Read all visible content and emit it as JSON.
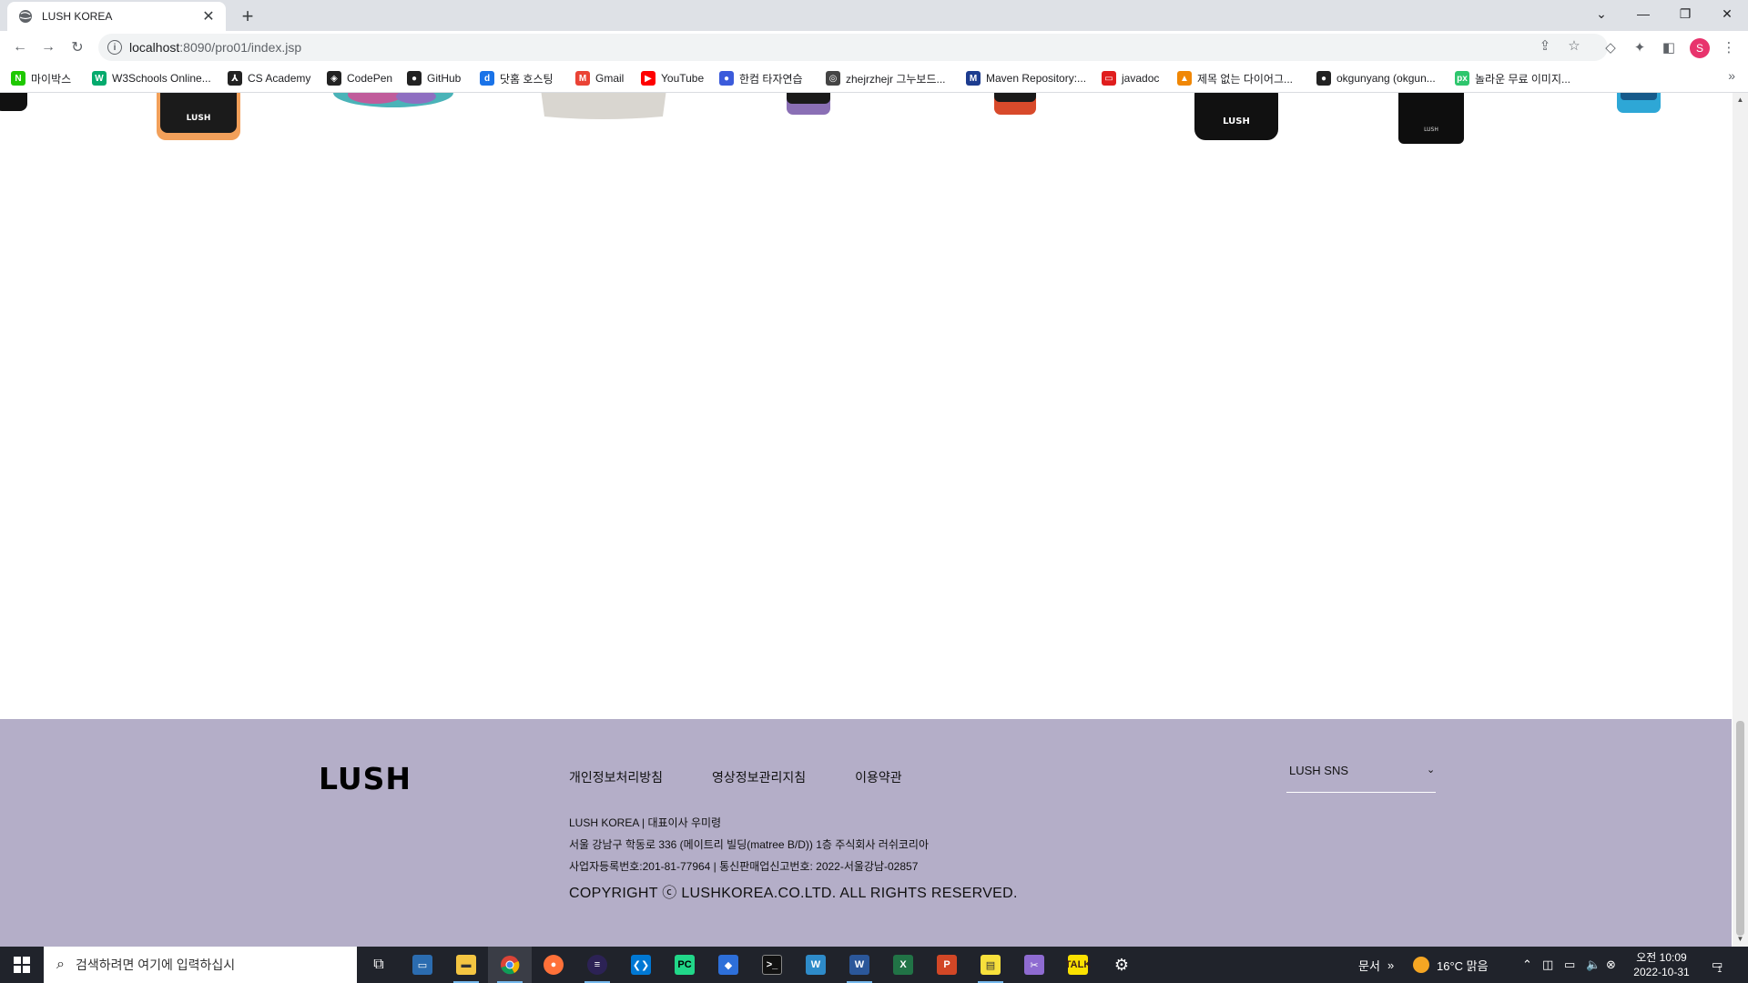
{
  "browser": {
    "tab_title": "LUSH KOREA",
    "url_host": "localhost",
    "url_rest": ":8090/pro01/index.jsp"
  },
  "bookmarks": [
    {
      "label": "마이박스",
      "icon": "naver-mybox-icon",
      "color": "#1ec800",
      "glyph": "N"
    },
    {
      "label": "W3Schools Online...",
      "icon": "w3schools-icon",
      "color": "#04aa6d",
      "glyph": "W"
    },
    {
      "label": "CS Academy",
      "icon": "cs-academy-icon",
      "color": "#222222",
      "glyph": "⅄"
    },
    {
      "label": "CodePen",
      "icon": "codepen-icon",
      "color": "#222222",
      "glyph": "◈"
    },
    {
      "label": "GitHub",
      "icon": "github-icon",
      "color": "#222222",
      "glyph": "●"
    },
    {
      "label": "닷홈 호스팅",
      "icon": "dothome-icon",
      "color": "#1a73e8",
      "glyph": "d"
    },
    {
      "label": "Gmail",
      "icon": "gmail-icon",
      "color": "#ea4335",
      "glyph": "M"
    },
    {
      "label": "YouTube",
      "icon": "youtube-icon",
      "color": "#ff0000",
      "glyph": "▶"
    },
    {
      "label": "한컴 타자연습",
      "icon": "hancom-icon",
      "color": "#3b5bdb",
      "glyph": "●"
    },
    {
      "label": "zhejrzhejr 그누보드...",
      "icon": "globe-icon",
      "color": "#444444",
      "glyph": "◎"
    },
    {
      "label": "Maven Repository:...",
      "icon": "maven-icon",
      "color": "#1d3c8f",
      "glyph": "M"
    },
    {
      "label": "javadoc",
      "icon": "oracle-icon",
      "color": "#e01e1e",
      "glyph": "▭"
    },
    {
      "label": "제목 없는 다이어그...",
      "icon": "diagram-icon",
      "color": "#f08705",
      "glyph": "▲"
    },
    {
      "label": "okgunyang (okgun...",
      "icon": "github-icon",
      "color": "#222222",
      "glyph": "●"
    },
    {
      "label": "놀라운 무료 이미지...",
      "icon": "pixabay-icon",
      "color": "#2ec66d",
      "glyph": "px"
    }
  ],
  "footer": {
    "logo": "LUSH",
    "policies": [
      "개인정보처리방침",
      "영상정보관리지침",
      "이용약관"
    ],
    "company_line": "LUSH KOREA | 대표이사 우미령",
    "address_line": "서울 강남구 학동로 336 (메이트리 빌딩(matree B/D)) 1층 주식회사 러쉬코리아",
    "registration_line": "사업자등록번호:201-81-77964 | 통신판매업신고번호: 2022-서울강남-02857",
    "copyright": "COPYRIGHT ⓒ LUSHKOREA.CO.LTD. ALL RIGHTS RESERVED.",
    "sns_select": "LUSH SNS"
  },
  "taskbar": {
    "search_placeholder": "검색하려면 여기에 입력하십시",
    "tray_label": "문서",
    "weather": "16°C  맑음",
    "time": "오전 10:09",
    "date": "2022-10-31",
    "notification_count": "1"
  },
  "colors": {
    "footer_bg": "#b4aec8",
    "tab_strip": "#dee1e6",
    "taskbar": "#20232b"
  }
}
